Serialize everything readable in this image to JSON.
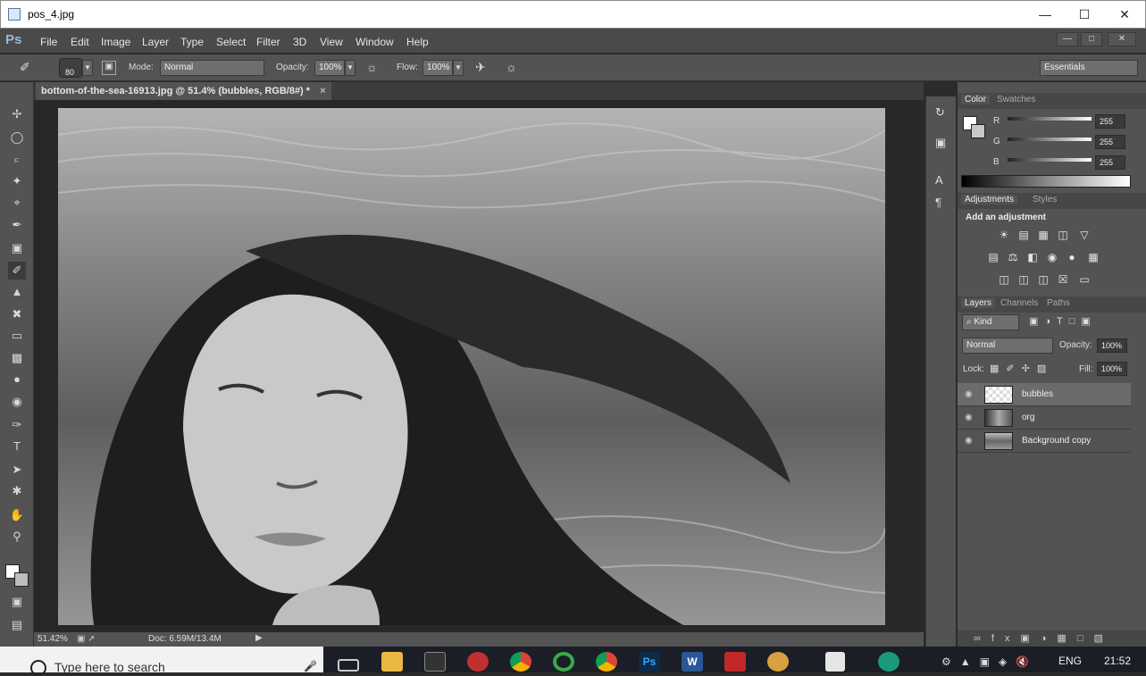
{
  "window": {
    "title": "pos_4.jpg",
    "min": "—",
    "max": "☐",
    "close": "✕"
  },
  "menubar": {
    "logo": "Ps",
    "items": [
      "File",
      "Edit",
      "Image",
      "Layer",
      "Type",
      "Select",
      "Filter",
      "3D",
      "View",
      "Window",
      "Help"
    ]
  },
  "options": {
    "brush_size": "80",
    "mode_label": "Mode:",
    "mode_value": "Normal",
    "opacity_label": "Opacity:",
    "opacity_value": "100%",
    "flow_label": "Flow:",
    "flow_value": "100%",
    "workspace": "Essentials"
  },
  "document": {
    "tab_title": "bottom-of-the-sea-16913.jpg @ 51.4% (bubbles, RGB/8#) *",
    "tab_close": "×"
  },
  "status": {
    "zoom": "51.42%",
    "doc": "Doc: 6.59M/13.4M"
  },
  "color_panel": {
    "tabs": [
      "Color",
      "Swatches"
    ],
    "r_label": "R",
    "g_label": "G",
    "b_label": "B",
    "r": "255",
    "g": "255",
    "b": "255"
  },
  "adjust_panel": {
    "tabs": [
      "Adjustments",
      "Styles"
    ],
    "heading": "Add an adjustment"
  },
  "layers_panel": {
    "tabs": [
      "Layers",
      "Channels",
      "Paths"
    ],
    "filter": "⌕ Kind",
    "blend": "Normal",
    "opacity_label": "Opacity:",
    "opacity": "100%",
    "lock_label": "Lock:",
    "fill_label": "Fill:",
    "fill": "100%",
    "layers": [
      {
        "name": "bubbles"
      },
      {
        "name": "org"
      },
      {
        "name": "Background copy"
      }
    ]
  },
  "taskbar": {
    "search_placeholder": "Type here to search",
    "lang": "ENG",
    "time": "21:52"
  },
  "colors": {
    "ps_blue": "#9ab8d8",
    "selected_layer": "#6b6b6b"
  }
}
